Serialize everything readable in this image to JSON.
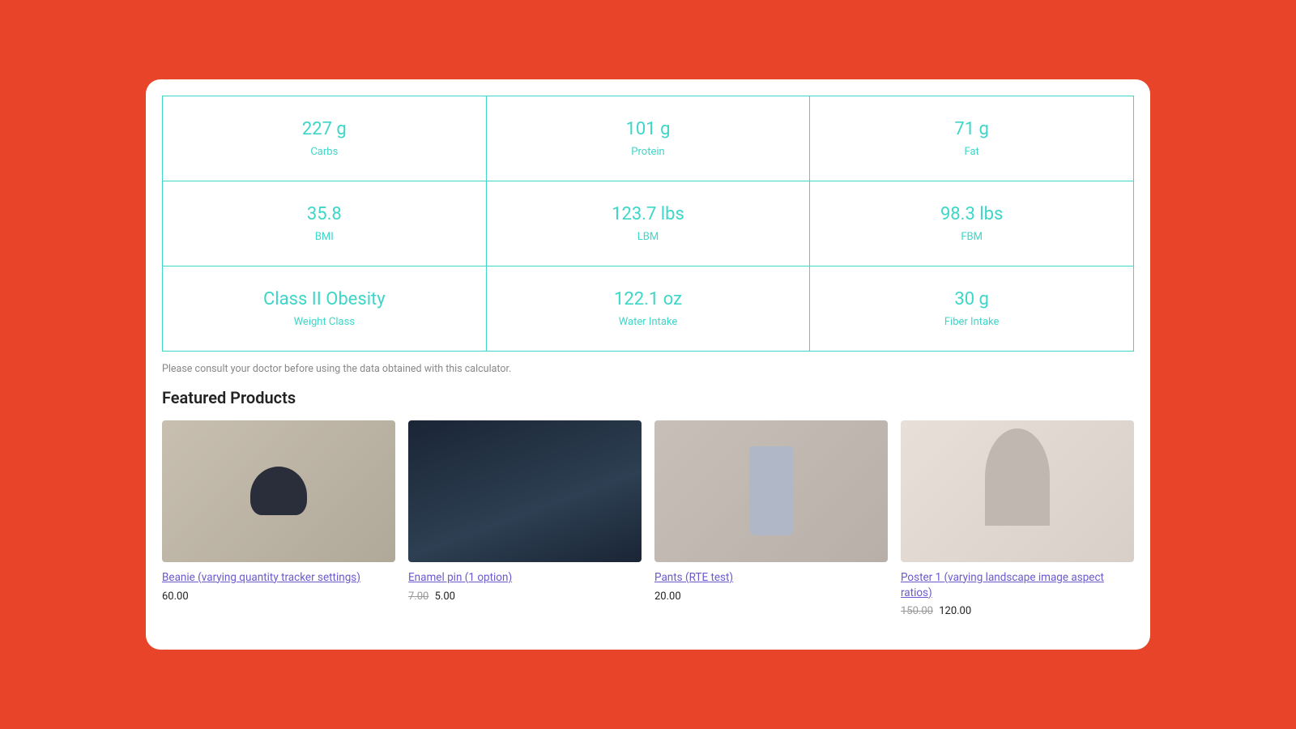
{
  "metrics": {
    "rows": [
      [
        {
          "value": "227 g",
          "label": "Carbs"
        },
        {
          "value": "101 g",
          "label": "Protein"
        },
        {
          "value": "71 g",
          "label": "Fat"
        }
      ],
      [
        {
          "value": "35.8",
          "label": "BMI"
        },
        {
          "value": "123.7 lbs",
          "label": "LBM"
        },
        {
          "value": "98.3 lbs",
          "label": "FBM"
        }
      ],
      [
        {
          "value": "Class II Obesity",
          "label": "Weight Class"
        },
        {
          "value": "122.1 oz",
          "label": "Water Intake"
        },
        {
          "value": "30 g",
          "label": "Fiber Intake"
        }
      ]
    ]
  },
  "disclaimer": "Please consult your doctor before using the data obtained with this calculator.",
  "featured": {
    "title": "Featured Products",
    "products": [
      {
        "id": "beanie",
        "name": "Beanie (varying quantity tracker settings)",
        "price_original": null,
        "price": "60.00",
        "image_type": "beanie"
      },
      {
        "id": "pin",
        "name": "Enamel pin (1 option)",
        "price_original": "7.00",
        "price": "5.00",
        "image_type": "pin"
      },
      {
        "id": "pants",
        "name": "Pants (RTE test)",
        "price_original": null,
        "price": "20.00",
        "image_type": "pants"
      },
      {
        "id": "poster",
        "name": "Poster 1 (varying landscape image aspect ratios)",
        "price_original": "150.00",
        "price": "120.00",
        "image_type": "poster"
      }
    ]
  }
}
